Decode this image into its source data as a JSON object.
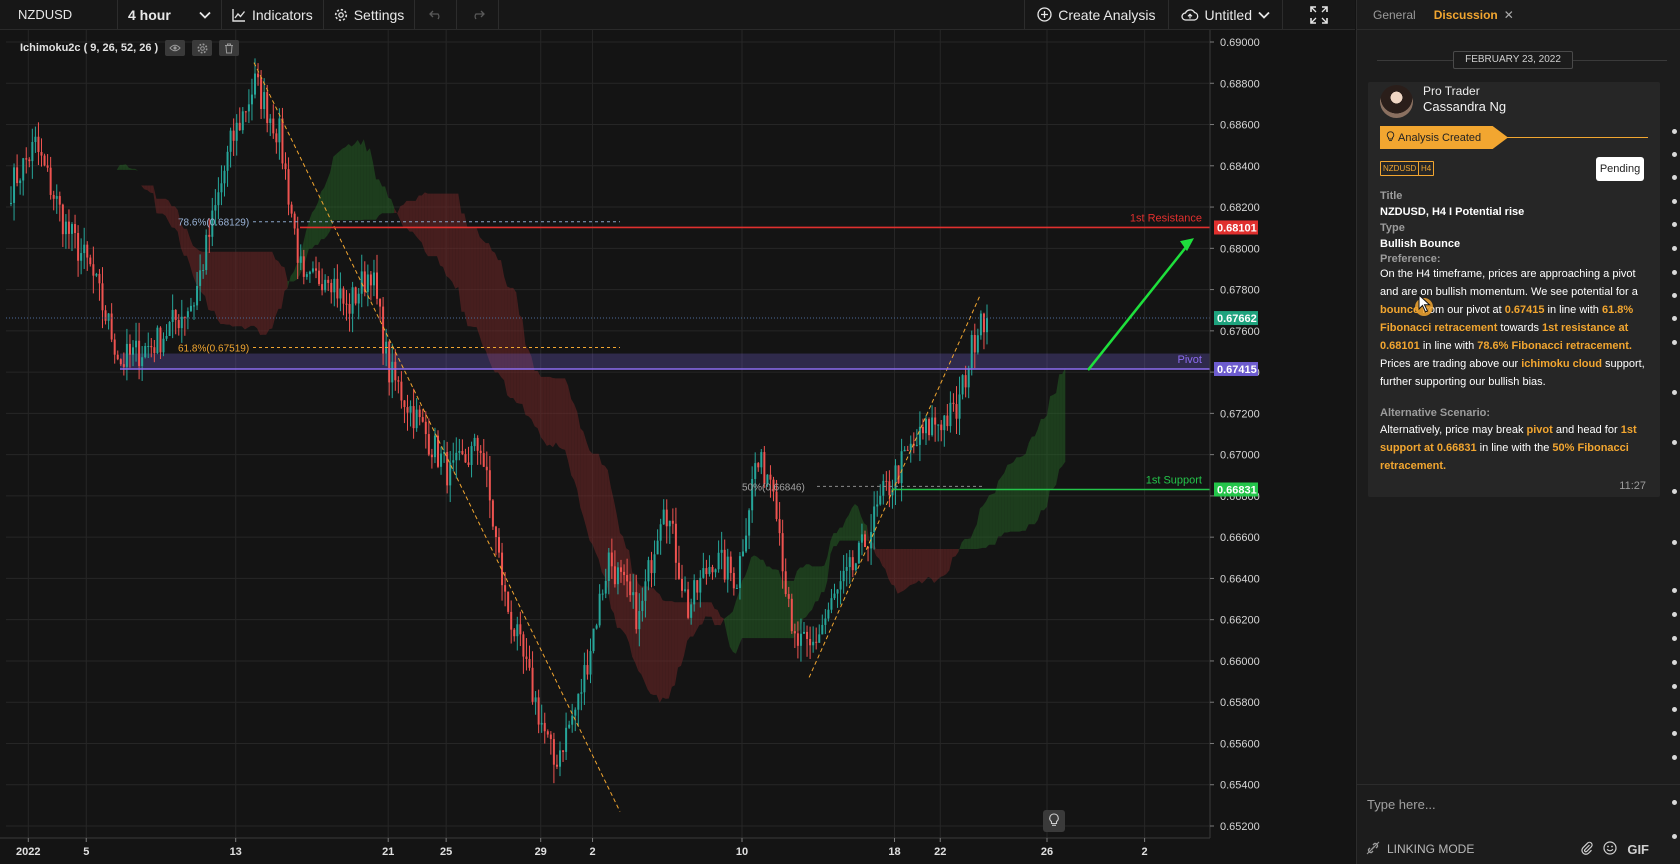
{
  "toolbar": {
    "symbol": "NZDUSD",
    "timeframe": "4 hour",
    "indicators_label": "Indicators",
    "settings_label": "Settings",
    "create_analysis_label": "Create Analysis",
    "layout_label": "Untitled"
  },
  "indicator": {
    "label": "Ichimoku2c ( 9, 26, 52, 26 )"
  },
  "chart_data": {
    "type": "candlestick",
    "symbol": "NZDUSD",
    "timeframe": "H4",
    "ylim": [
      0.652,
      0.69
    ],
    "y_ticks": [
      0.652,
      0.654,
      0.656,
      0.658,
      0.66,
      0.662,
      0.664,
      0.666,
      0.668,
      0.67,
      0.672,
      0.674,
      0.676,
      0.678,
      0.68,
      0.682,
      0.684,
      0.686,
      0.688,
      0.69
    ],
    "x_ticks": [
      {
        "label": "2022",
        "bar": 6
      },
      {
        "label": "5",
        "bar": 25
      },
      {
        "label": "13",
        "bar": 74
      },
      {
        "label": "21",
        "bar": 124
      },
      {
        "label": "25",
        "bar": 143
      },
      {
        "label": "29",
        "bar": 174
      },
      {
        "label": "2",
        "bar": 191
      },
      {
        "label": "10",
        "bar": 240
      },
      {
        "label": "18",
        "bar": 290
      },
      {
        "label": "22",
        "bar": 305
      },
      {
        "label": "26",
        "bar": 340
      },
      {
        "label": "2",
        "bar": 372
      }
    ],
    "price_path": [
      [
        0,
        0.683
      ],
      [
        8,
        0.685
      ],
      [
        18,
        0.681
      ],
      [
        26,
        0.679
      ],
      [
        36,
        0.6745
      ],
      [
        48,
        0.6755
      ],
      [
        60,
        0.6775
      ],
      [
        72,
        0.685
      ],
      [
        80,
        0.688
      ],
      [
        88,
        0.6855
      ],
      [
        96,
        0.678
      ],
      [
        104,
        0.679
      ],
      [
        110,
        0.677
      ],
      [
        118,
        0.679
      ],
      [
        124,
        0.674
      ],
      [
        134,
        0.6715
      ],
      [
        144,
        0.669
      ],
      [
        154,
        0.6705
      ],
      [
        162,
        0.663
      ],
      [
        170,
        0.659
      ],
      [
        178,
        0.655
      ],
      [
        186,
        0.658
      ],
      [
        196,
        0.665
      ],
      [
        206,
        0.662
      ],
      [
        214,
        0.668
      ],
      [
        222,
        0.6625
      ],
      [
        230,
        0.665
      ],
      [
        238,
        0.664
      ],
      [
        244,
        0.6695
      ],
      [
        250,
        0.669
      ],
      [
        256,
        0.661
      ],
      [
        262,
        0.6605
      ],
      [
        270,
        0.663
      ],
      [
        278,
        0.665
      ],
      [
        286,
        0.668
      ],
      [
        294,
        0.67
      ],
      [
        302,
        0.6715
      ],
      [
        310,
        0.672
      ],
      [
        314,
        0.6745
      ],
      [
        318,
        0.677
      ],
      [
        320,
        0.6764
      ]
    ],
    "current_price": 0.67662,
    "levels": [
      {
        "label": "1st Resistance",
        "price": 0.68101,
        "color": "#e0302e"
      },
      {
        "label": "Pivot",
        "price": 0.67415,
        "color": "#8c6cf0"
      },
      {
        "label": "1st Support",
        "price": 0.66831,
        "color": "#24c44a"
      }
    ],
    "price_tags": [
      {
        "value": "0.68101",
        "price": 0.68101,
        "color": "#e0302e"
      },
      {
        "value": "0.67662",
        "price": 0.67662,
        "color": "#1fa37e"
      },
      {
        "value": "0.67415",
        "price": 0.67415,
        "color": "#6d5ccf"
      },
      {
        "value": "0.66831",
        "price": 0.66831,
        "color": "#24c44a"
      }
    ],
    "fib_labels": [
      {
        "text": "78.6%(0.68129)",
        "price": 0.68129
      },
      {
        "text": "61.8%(0.67519)",
        "price": 0.67519
      },
      {
        "text": "50%(0.66846)",
        "price": 0.66846
      }
    ],
    "colors": {
      "up": "#26a69a",
      "down": "#ef5350",
      "fib": "#f2a630",
      "arrow": "#1ee03c"
    }
  },
  "panel": {
    "tabs": {
      "general": "General",
      "discussion": "Discussion"
    },
    "date": "FEBRUARY 23, 2022",
    "author": {
      "role": "Pro Trader",
      "name": "Cassandra Ng"
    },
    "event": "Analysis Created",
    "tags": {
      "symbol": "NZDUSD",
      "tf": "H4"
    },
    "status": "Pending",
    "title_label": "Title",
    "title_value": "NZDUSD, H4 I Potential rise",
    "type_label": "Type",
    "type_value": "Bullish Bounce",
    "preference_label": "Preference:",
    "pref": {
      "t1": "On the H4 timeframe, prices are approaching a pivot and are on bullish momentum. We see potential for a ",
      "h1": "bounce",
      "t2": " from our pivot at ",
      "h2": "0.67415",
      "t3": " in line with ",
      "h3": "61.8% Fibonacci retracement",
      "t4": " towards ",
      "h4": "1st resistance at 0.68101",
      "t5": " in line with ",
      "h5": "78.6% Fibonacci retracement.",
      "t6": " Prices are trading above our ",
      "h6": "ichimoku cloud",
      "t7": " support, further supporting our bullish bias."
    },
    "alt_label": "Alternative Scenario:",
    "alt": {
      "t1": "Alternatively, price may break ",
      "h1": "pivot",
      "t2": " and head for ",
      "h2": "1st support at 0.66831",
      "t3": " in line with the ",
      "h3": "50% Fibonacci retracement."
    },
    "time": "11:27",
    "input_placeholder": "Type here...",
    "linking_mode": "LINKING MODE",
    "gif": "GIF"
  }
}
